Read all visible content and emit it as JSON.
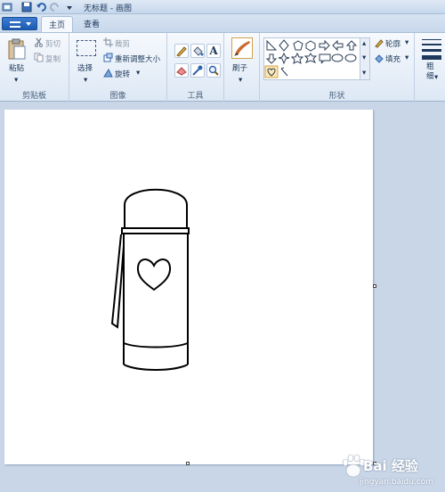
{
  "window": {
    "title": "无标题 - 画图"
  },
  "tabs": [
    {
      "label": "主页"
    },
    {
      "label": "查看"
    }
  ],
  "clipboard": {
    "paste_label": "粘贴",
    "cut_label": "剪切",
    "copy_label": "复制",
    "group_label": "剪贴板"
  },
  "image": {
    "select_label": "选择",
    "crop_label": "裁剪",
    "resize_label": "重新调整大小",
    "rotate_label": "旋转",
    "group_label": "图像"
  },
  "tools": {
    "group_label": "工具"
  },
  "brushes": {
    "label": "刷子"
  },
  "shapes": {
    "group_label": "形状",
    "outline_label": "轮廓",
    "fill_label": "填充"
  },
  "size": {
    "label": "粗细"
  },
  "watermark": {
    "text": "Bai 经验",
    "url": "jingyan.baidu.com"
  }
}
